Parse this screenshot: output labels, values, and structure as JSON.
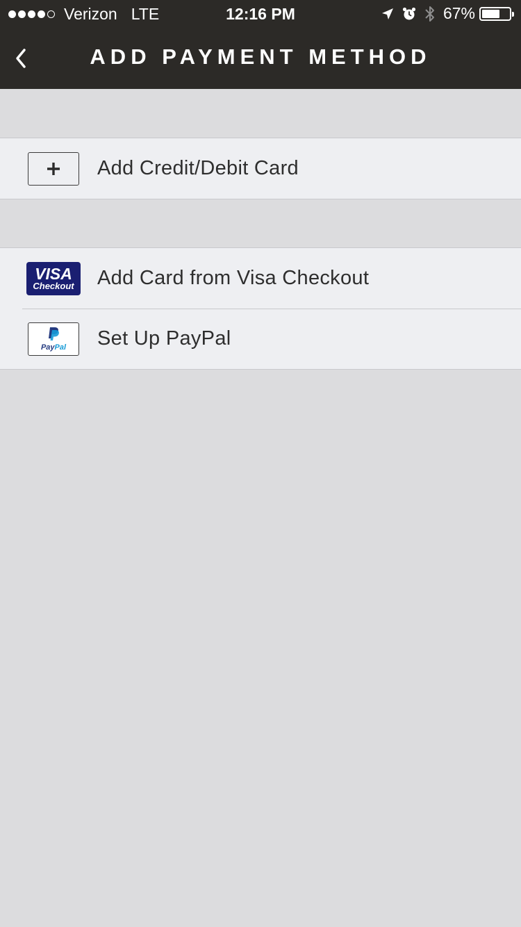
{
  "status_bar": {
    "carrier": "Verizon",
    "network": "LTE",
    "time": "12:16 PM",
    "battery_percent": "67%",
    "battery_level": 0.67,
    "signal_bars_filled": 4,
    "signal_bars_total": 5,
    "icons": [
      "location-arrow-icon",
      "alarm-icon",
      "bluetooth-icon",
      "battery-icon"
    ]
  },
  "nav": {
    "back_icon": "chevron-left-icon",
    "title": "ADD PAYMENT METHOD"
  },
  "payment_options": {
    "add_card": {
      "icon": "plus-icon",
      "label": "Add Credit/Debit Card"
    },
    "visa_checkout": {
      "icon": "visa-checkout-logo",
      "logo_line1": "VISA",
      "logo_line2": "Checkout",
      "label": "Add Card from Visa Checkout"
    },
    "paypal": {
      "icon": "paypal-logo",
      "logo_text_pay": "Pay",
      "logo_text_pal": "Pal",
      "label": "Set Up PayPal"
    }
  },
  "colors": {
    "nav_bg": "#2c2a27",
    "page_bg": "#dcdcde",
    "row_bg": "#eeeff2",
    "visa_blue": "#1a1f71",
    "paypal_dark": "#253b80",
    "paypal_light": "#179bd7"
  }
}
